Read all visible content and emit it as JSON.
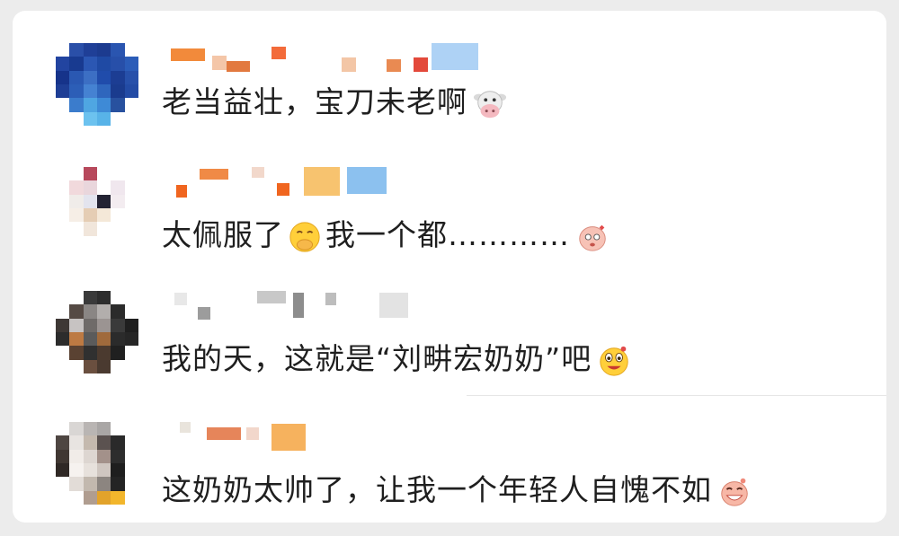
{
  "comments": [
    {
      "text": "老当益壮，宝刀未老啊",
      "emoji": "cow-face-icon"
    },
    {
      "text_before": "太佩服了",
      "emoji_mid": "hand-over-mouth-face-icon",
      "text_after": "我一个都…………",
      "emoji": "pink-sticker-icon"
    },
    {
      "text": "我的天，这就是“刘畊宏奶奶”吧",
      "emoji": "grinning-face-icon"
    },
    {
      "text": "这奶奶太帅了，让我一个年轻人自愧不如",
      "emoji": "laughing-sticker-icon"
    }
  ]
}
